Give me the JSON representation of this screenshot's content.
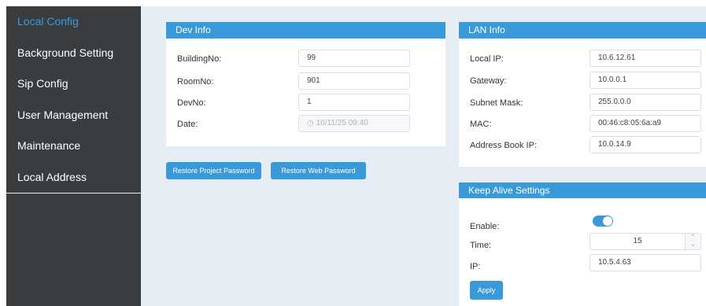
{
  "sidebar": {
    "items": [
      {
        "label": "Local Config"
      },
      {
        "label": "Background Setting"
      },
      {
        "label": "Sip Config"
      },
      {
        "label": "User Management"
      },
      {
        "label": "Maintenance"
      },
      {
        "label": "Local Address"
      }
    ]
  },
  "dev_info": {
    "title": "Dev Info",
    "building_label": "BuildingNo:",
    "building_value": "99",
    "room_label": "RoomNo:",
    "room_value": "901",
    "dev_label": "DevNo:",
    "dev_value": "1",
    "date_label": "Date:",
    "date_value": "10/11/25 09:40"
  },
  "buttons": {
    "restore_project_password": "Restore Project Password",
    "restore_web_password": "Restore Web Password",
    "apply": "Apply"
  },
  "lan_info": {
    "title": "LAN Info",
    "local_ip_label": "Local IP:",
    "local_ip_value": "10.6.12.61",
    "gateway_label": "Gateway:",
    "gateway_value": "10.0.0.1",
    "subnet_label": "Subnet Mask:",
    "subnet_value": "255.0.0.0",
    "mac_label": "MAC:",
    "mac_value": "00:46:c8:05:6a:a9",
    "address_book_label": "Address Book IP:",
    "address_book_value": "10.0.14.9"
  },
  "keep_alive": {
    "title": "Keep Alive Settings",
    "enable_label": "Enable:",
    "enabled": true,
    "time_label": "Time:",
    "time_value": "15",
    "ip_label": "IP:",
    "ip_value": "10.5.4.63"
  },
  "colors": {
    "accent": "#3a9ad9",
    "sidebar_bg": "#3a3d40",
    "main_bg": "#e7edf4"
  }
}
